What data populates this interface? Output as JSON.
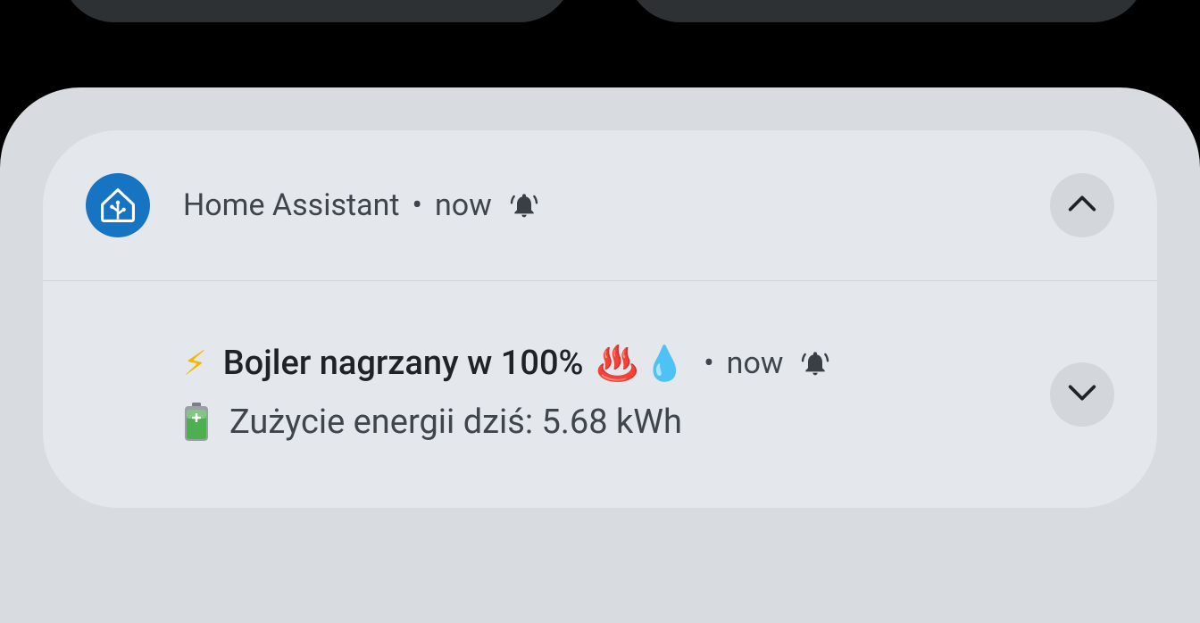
{
  "notification_group": {
    "app_name": "Home Assistant",
    "time": "now",
    "separator": "•",
    "app_icon": "home-assistant-icon",
    "alert_icon": "bell-alert-icon",
    "collapse_icon": "chevron-up-icon",
    "accent_color": "#1774c2"
  },
  "message": {
    "title_leading_emoji": "⚡",
    "title": "Bojler nagrzany w 100%",
    "title_trailing_emoji_1": "♨️",
    "title_trailing_emoji_2": "💧",
    "separator": "•",
    "time": "now",
    "alert_icon": "bell-alert-icon",
    "body_leading_emoji": "🔋",
    "body": "Zużycie energii dziś: 5.68 kWh",
    "expand_icon": "chevron-down-icon"
  }
}
